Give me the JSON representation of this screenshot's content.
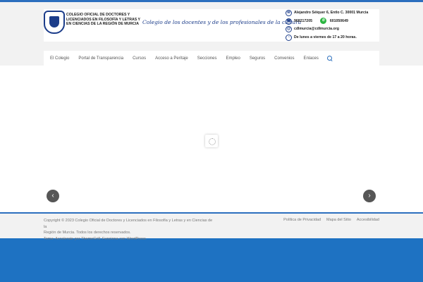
{
  "header": {
    "logo": {
      "name_lines": [
        "COLEGIO OFICIAL DE DOCTORES Y",
        "LICENCIADOS EN FILOSOFÍA Y LETRAS Y",
        "EN CIENCIAS DE LA REGIÓN DE MURCIA"
      ]
    },
    "tagline": "Colegio de los docentes y de los profesionales de la cultura",
    "contact": {
      "address": "Alejandro Séiquer 6, Entlo C. 30001 Murcia",
      "phone": "968217205",
      "whatsapp": "601050649",
      "email": "cdlmurcia@cdlmurcia.org",
      "hours": "De lunes a viernes de 17 a 20 horas."
    }
  },
  "nav": {
    "items": [
      "El Colegio",
      "Portal de Transparencia",
      "Cursos",
      "Acceso a Peritaje",
      "Secciones",
      "Empleo",
      "Seguros",
      "Convenios",
      "Enlaces"
    ]
  },
  "slider": {
    "prev_icon": "‹",
    "next_icon": "›"
  },
  "footer": {
    "copyright_line1": "Copyright © 2023 Colegio Oficial de Doctores y Licenciados en Filosofía y Letras y en Ciencias de la",
    "copyright_line2": "Región de Murcia. Todos los derechos reservados.",
    "credits": "Tema: Accelerate por ThemeGrill. Funciona con WordPress.",
    "links": [
      "Política de Privacidad",
      "Mapa del Sitio",
      "Accesibilidad"
    ]
  },
  "colors": {
    "accent": "#2c6fbe",
    "bottom_band": "#1e72c2",
    "background": "#f2f2f2"
  }
}
